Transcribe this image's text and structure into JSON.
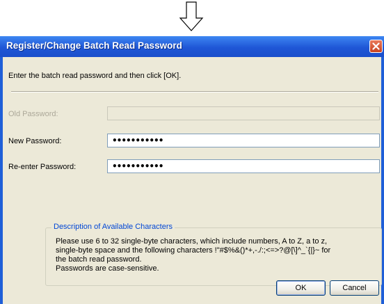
{
  "arrow_icon": "down-arrow-icon",
  "dialog": {
    "title": "Register/Change Batch Read Password",
    "close_icon": "close-icon",
    "instruction": "Enter the batch read password and then click [OK].",
    "old_password": {
      "label": "Old Password:",
      "value": "",
      "enabled": false
    },
    "new_password": {
      "label": "New Password:",
      "value": "•••••••••••"
    },
    "reenter_password": {
      "label": "Re-enter Password:",
      "value": "•••••••••••"
    },
    "description": {
      "title": "Description of Available Characters",
      "lines": [
        "Please use 6 to 32 single-byte characters, which include numbers, A to Z, a to z,",
        "single-byte space and the following characters !\"#$%&()*+,-./:;<=>?@[\\]^_`{|}~ for",
        "the batch read password.",
        "Passwords are case-sensitive."
      ]
    },
    "buttons": {
      "ok": "OK",
      "cancel": "Cancel"
    },
    "colors": {
      "titlebar": "#1f5fd8",
      "client": "#ece9d8",
      "group_title": "#0046d5"
    }
  }
}
